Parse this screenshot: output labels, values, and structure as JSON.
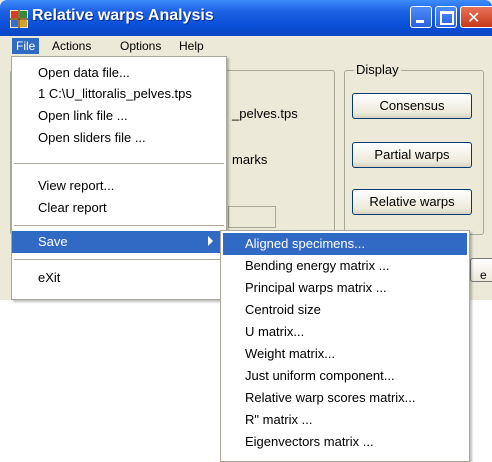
{
  "window": {
    "title": "Relative warps Analysis",
    "colors": {
      "titlebar": "#0a4fd8",
      "highlight": "#316ac5",
      "face": "#ece9d8"
    }
  },
  "menubar": {
    "items": [
      "File",
      "Actions",
      "Options",
      "Help"
    ]
  },
  "background": {
    "display_label": "Display",
    "buttons": [
      "Consensus",
      "Partial warps",
      "Relative warps"
    ],
    "file_fragment": "_pelves.tps",
    "marks_fragment": "marks",
    "edge_fragment": "e"
  },
  "file_menu": {
    "items": [
      "Open data file...",
      "1 C:\\U_littoralis_pelves.tps",
      "Open link file ...",
      "Open sliders file ...",
      "View report...",
      "Clear report",
      "Save",
      "eXit"
    ]
  },
  "save_submenu": {
    "items": [
      "Aligned specimens...",
      "Bending energy matrix ...",
      "Principal warps matrix ...",
      "Centroid size",
      "U matrix...",
      "Weight matrix...",
      "Just uniform component...",
      "Relative warp scores matrix...",
      "R\" matrix ...",
      "Eigenvectors matrix ..."
    ]
  }
}
